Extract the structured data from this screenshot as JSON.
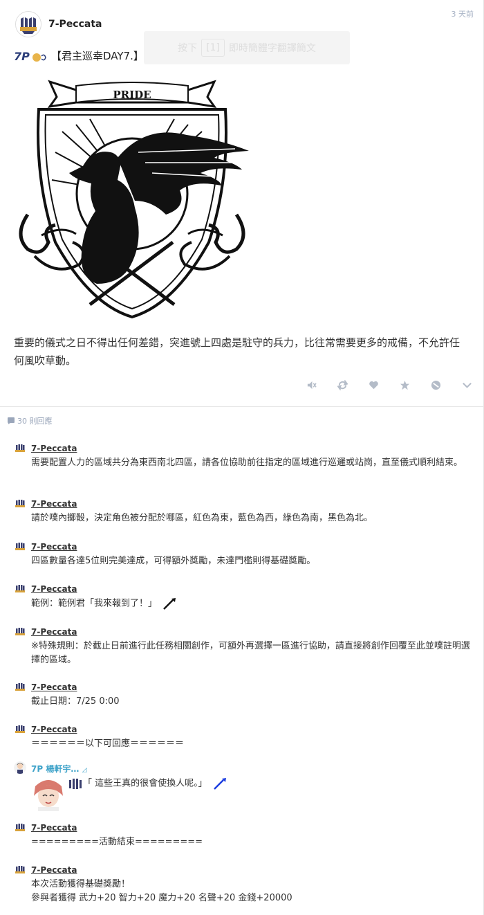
{
  "post": {
    "author": "7-Peccata",
    "time": "3 天前",
    "toast": {
      "pre": "按下",
      "key": "[1]",
      "post": "即時簡體字翻譯簡文"
    },
    "title": "【君主巡幸DAY7.】",
    "crest_banner": "PRIDE",
    "body": "重要的儀式之日不得出任何差錯，突進號上四處是駐守的兵力，比往常需要更多的戒備，不允許任何風吹草動。",
    "actions": [
      "mute-icon",
      "repost-icon",
      "heart-icon",
      "star-icon",
      "block-icon",
      "chevron-down-icon"
    ]
  },
  "comments": {
    "count_label": "30 則回應",
    "items": [
      {
        "name": "7-Peccata",
        "text": "需要配置人力的區域共分為東西南北四區，請各位協助前往指定的區域進行巡邏或站崗，直至儀式順利結束。"
      },
      {
        "name": "7-Peccata",
        "text": "請於噗內擲骰，決定角色被分配於哪區，紅色為東，藍色為西，綠色為南，黑色為北。"
      },
      {
        "name": "7-Peccata",
        "text": "四區數量各達5位則完美達成，可得額外獎勵，未達門檻則得基礎獎勵。"
      },
      {
        "name": "7-Peccata",
        "text": "範例：範例君「我來報到了！」"
      },
      {
        "name": "7-Peccata",
        "text": "※特殊規則：於截止日前進行此任務相關創作，可額外再選擇一區進行協助，請直接將創作回覆至此並噗註明選擇的區域。"
      },
      {
        "name": "7-Peccata",
        "text": "截止日期：7/25 0:00"
      },
      {
        "name": "7-Peccata",
        "text": "＝＝＝＝＝＝以下可回應＝＝＝＝＝＝"
      },
      {
        "name": "7P 楊軒宇…",
        "text": "「 這些王真的很會使換人呢。」"
      },
      {
        "name": "7-Peccata",
        "text": "=========活動結束========="
      },
      {
        "name": "7-Peccata",
        "text": "本次活動獲得基礎獎勵！",
        "text2": "參與者獲得 武力+20 智力+20 魔力+20 名聲+20 金錢+20000"
      }
    ]
  },
  "colors": {
    "accent_blue": "#3fa3c9",
    "muted": "#a9b4c6",
    "pin_blue": "#1d3ee0"
  }
}
